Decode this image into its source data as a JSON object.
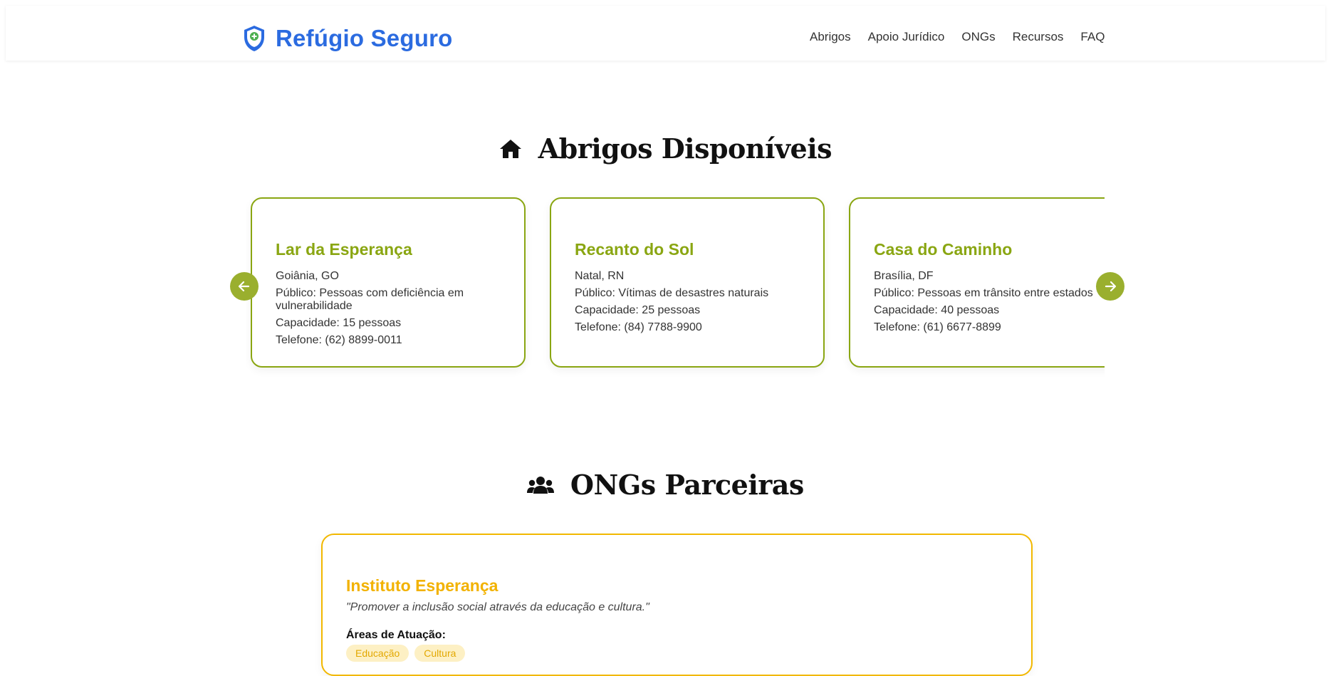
{
  "header": {
    "brand": "Refúgio Seguro",
    "nav": [
      "Abrigos",
      "Apoio Jurídico",
      "ONGs",
      "Recursos",
      "FAQ"
    ]
  },
  "shelters": {
    "title": "Abrigos Disponíveis",
    "cards": [
      {
        "name": "Lar da Esperança",
        "location": "Goiânia, GO",
        "audience": "Público: Pessoas com deficiência em vulnerabilidade",
        "capacity": "Capacidade: 15 pessoas",
        "phone": "Telefone: (62) 8899-0011"
      },
      {
        "name": "Recanto do Sol",
        "location": "Natal, RN",
        "audience": "Público: Vítimas de desastres naturais",
        "capacity": "Capacidade: 25 pessoas",
        "phone": "Telefone: (84) 7788-9900"
      },
      {
        "name": "Casa do Caminho",
        "location": "Brasília, DF",
        "audience": "Público: Pessoas em trânsito entre estados",
        "capacity": "Capacidade: 40 pessoas",
        "phone": "Telefone: (61) 6677-8899"
      }
    ]
  },
  "ngos": {
    "title": "ONGs Parceiras",
    "card": {
      "name": "Instituto Esperança",
      "mission": "\"Promover a inclusão social através da educação e cultura.\"",
      "areas_label": "Áreas de Atuação:",
      "tags": [
        "Educação",
        "Cultura"
      ]
    }
  },
  "colors": {
    "brand": "#2b6be0",
    "shelter_accent": "#8aa612",
    "arrow": "#9aaf2e",
    "ngo_accent": "#f2b800",
    "tag_bg": "#fdf0c4"
  },
  "icons": {
    "logo": "shield-heart-hands-icon",
    "shelters_title": "home-icon",
    "ngos_title": "users-icon",
    "prev": "arrow-left-icon",
    "next": "arrow-right-icon"
  }
}
